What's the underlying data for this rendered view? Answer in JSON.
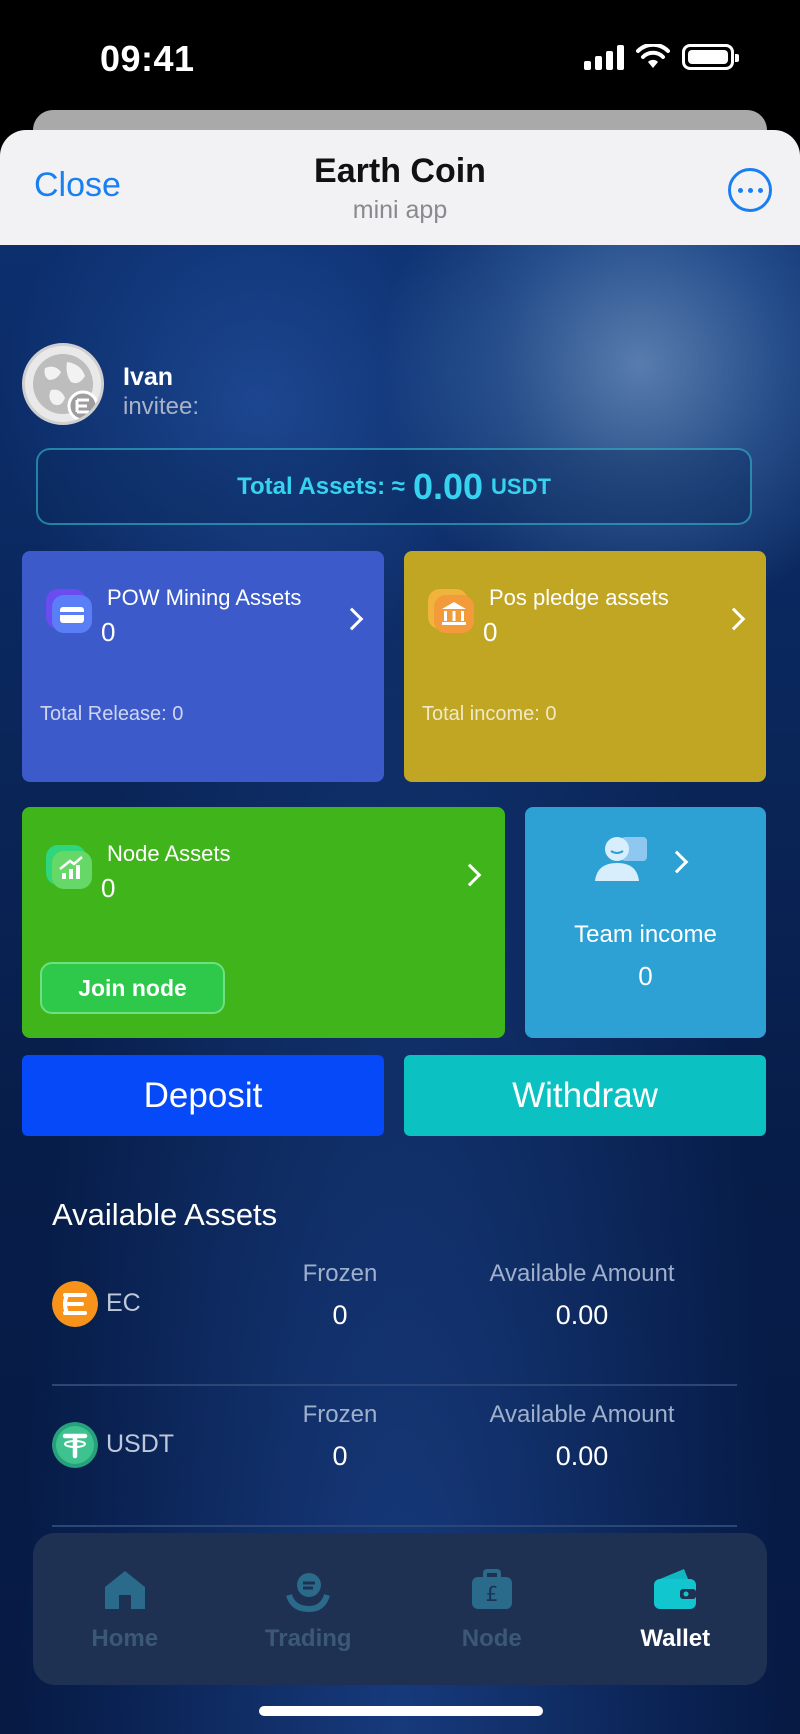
{
  "status_bar": {
    "time": "09:41"
  },
  "header": {
    "close_label": "Close",
    "title": "Earth Coin",
    "subtitle": "mini app"
  },
  "user": {
    "name": "Ivan",
    "invitee_label": "invitee:",
    "invitee_value": ""
  },
  "total_assets": {
    "label": "Total Assets: ≈",
    "value": "0.00",
    "unit": "USDT"
  },
  "cards": {
    "pow": {
      "title": "POW Mining Assets",
      "value": "0",
      "footer": "Total Release: 0",
      "color": "#3c5ac9"
    },
    "pos": {
      "title": "Pos pledge assets",
      "value": "0",
      "footer": "Total income: 0",
      "color": "#c1a623"
    },
    "node": {
      "title": "Node Assets",
      "value": "0",
      "button": "Join node",
      "color": "#40b41b"
    },
    "team": {
      "title": "Team income",
      "value": "0",
      "color": "#2ea1d4"
    }
  },
  "actions": {
    "deposit": "Deposit",
    "withdraw": "Withdraw"
  },
  "available": {
    "title": "Available Assets",
    "rows": [
      {
        "name": "EC",
        "icon": "ec-coin-icon",
        "frozen_label": "Frozen",
        "frozen": "0",
        "available_label": "Available Amount",
        "available": "0.00"
      },
      {
        "name": "USDT",
        "icon": "usdt-coin-icon",
        "frozen_label": "Frozen",
        "frozen": "0",
        "available_label": "Available Amount",
        "available": "0.00"
      }
    ]
  },
  "nav": {
    "items": [
      {
        "label": "Home",
        "icon": "home-icon",
        "active": false
      },
      {
        "label": "Trading",
        "icon": "trading-icon",
        "active": false
      },
      {
        "label": "Node",
        "icon": "node-icon",
        "active": false
      },
      {
        "label": "Wallet",
        "icon": "wallet-icon",
        "active": true
      }
    ]
  },
  "colors": {
    "accent": "#1a7ff0",
    "total_assets": "#35d3f0",
    "deposit": "#0649f8",
    "withdraw": "#0bc1c1"
  }
}
